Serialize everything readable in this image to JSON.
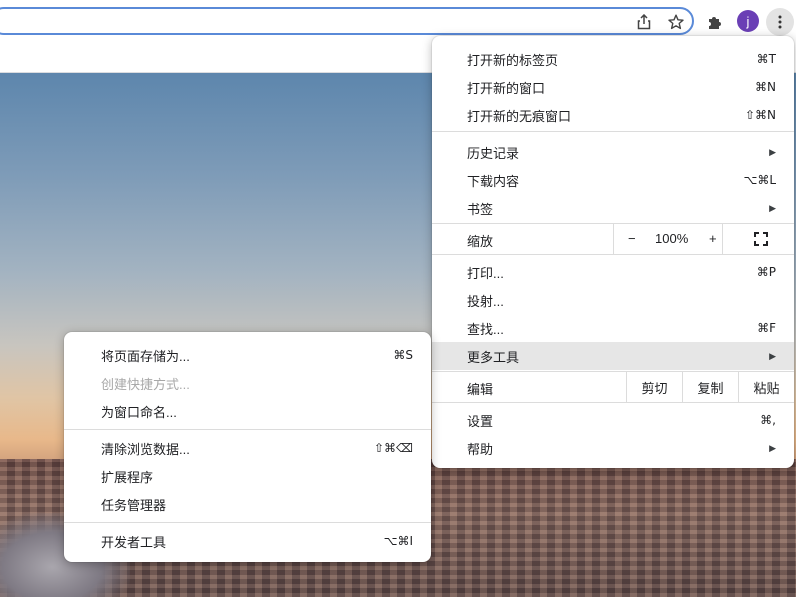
{
  "toolbar": {
    "avatar_letter": "j"
  },
  "main_menu": {
    "group1": [
      {
        "label": "打开新的标签页",
        "shortcut": "⌘T"
      },
      {
        "label": "打开新的窗口",
        "shortcut": "⌘N"
      },
      {
        "label": "打开新的无痕窗口",
        "shortcut": "⇧⌘N"
      }
    ],
    "group2": [
      {
        "label": "历史记录",
        "shortcut": ""
      },
      {
        "label": "下载内容",
        "shortcut": "⌥⌘L"
      },
      {
        "label": "书签",
        "shortcut": ""
      }
    ],
    "zoom": {
      "label": "缩放",
      "minus": "−",
      "value": "100%",
      "plus": "+"
    },
    "group3": [
      {
        "label": "打印...",
        "shortcut": "⌘P"
      },
      {
        "label": "投射...",
        "shortcut": ""
      },
      {
        "label": "查找...",
        "shortcut": "⌘F"
      },
      {
        "label": "更多工具",
        "shortcut": ""
      }
    ],
    "edit": {
      "label": "编辑",
      "cut": "剪切",
      "copy": "复制",
      "paste": "粘贴"
    },
    "group4": [
      {
        "label": "设置",
        "shortcut": "⌘,"
      },
      {
        "label": "帮助",
        "shortcut": ""
      }
    ]
  },
  "sub_menu": {
    "group1": [
      {
        "label": "将页面存储为...",
        "shortcut": "⌘S"
      },
      {
        "label": "创建快捷方式...",
        "shortcut": ""
      },
      {
        "label": "为窗口命名...",
        "shortcut": ""
      }
    ],
    "group2": [
      {
        "label": "清除浏览数据...",
        "shortcut": "⇧⌘⌫"
      },
      {
        "label": "扩展程序",
        "shortcut": ""
      },
      {
        "label": "任务管理器",
        "shortcut": ""
      }
    ],
    "group3": [
      {
        "label": "开发者工具",
        "shortcut": "⌥⌘I"
      }
    ]
  }
}
